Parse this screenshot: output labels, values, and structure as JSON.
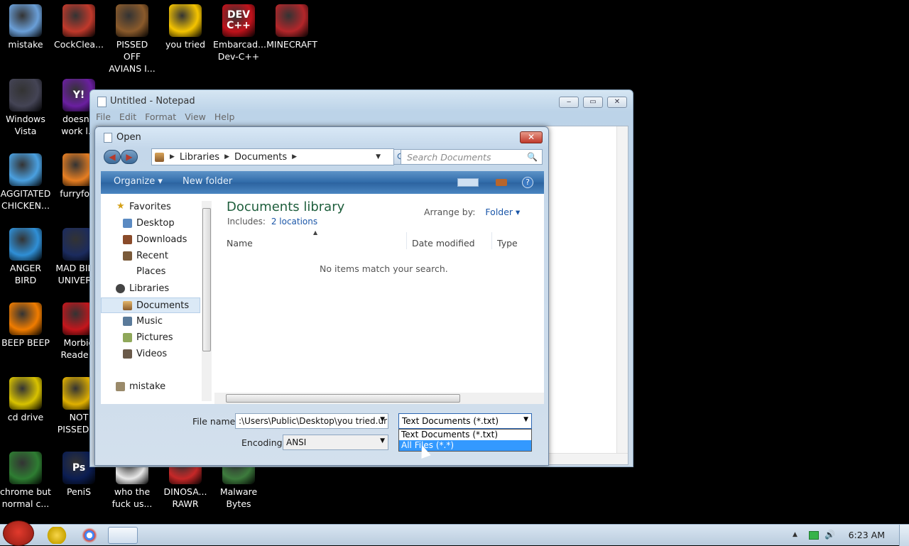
{
  "desktop_icons": [
    {
      "label": "mistake",
      "icon": "computer-icon",
      "color": "#6a9fd8"
    },
    {
      "label": "CockClea...",
      "icon": "ccleaner-icon",
      "color": "#c0392b"
    },
    {
      "label": "PISSED OFF\nAVIANS I...",
      "icon": "angry-birds-seasons-icon",
      "color": "#8a5a2b"
    },
    {
      "label": "you tried",
      "icon": "star-icon",
      "color": "#f5c400"
    },
    {
      "label": "Embarcad...\nDev-C++",
      "icon": "devcpp-icon",
      "color": "#c0121b",
      "glyph": "DEV\nC++"
    },
    {
      "label": "MINECRAFT",
      "icon": "minecraft-icon",
      "color": "#b3262a"
    },
    {
      "label": "Windows\nVista",
      "icon": "recycle-bin-icon",
      "color": "#445"
    },
    {
      "label": "doesn't\nwork l...",
      "icon": "yahoo-icon",
      "color": "#6a1fa0",
      "glyph": "Y!"
    },
    {
      "label": "AGGITATED\nCHICKEN...",
      "icon": "angry-birds-icon",
      "color": "#4aa0e0"
    },
    {
      "label": "furryfo...",
      "icon": "firefox-icon",
      "color": "#e67e22"
    },
    {
      "label": "ANGER\nBIRD",
      "icon": "angry-birds-icon",
      "color": "#2f8fd6"
    },
    {
      "label": "MAD BIR...\nUNIVER...",
      "icon": "angry-birds-space-icon",
      "color": "#1b2b5e"
    },
    {
      "label": "BEEP BEEP",
      "icon": "vlc-icon",
      "color": "#f07c00"
    },
    {
      "label": "Morbid\nReade...",
      "icon": "adobe-reader-icon",
      "color": "#c4161c"
    },
    {
      "label": "cd drive",
      "icon": "cd-drive-icon",
      "color": "#d8c200"
    },
    {
      "label": "NOT\nPISSED ...",
      "icon": "bad-piggies-icon",
      "color": "#e0b000"
    },
    {
      "label": "chrome but\nnormal c...",
      "icon": "chrome-icon",
      "color": "#2e7d32"
    },
    {
      "label": "PeniS",
      "icon": "photoshop-icon",
      "color": "#0b1d52",
      "glyph": "Ps"
    },
    {
      "label": "who the\nfuck us...",
      "icon": "bolt-icon",
      "color": "#e8e8e8"
    },
    {
      "label": "DINOSA...\nRAWR",
      "icon": "angry-birds-icon",
      "color": "#c62828"
    },
    {
      "label": "Malware\nBytes",
      "icon": "shield-check-icon",
      "color": "#3d7b3d"
    }
  ],
  "notepad": {
    "title": "Untitled - Notepad",
    "menu": [
      "File",
      "Edit",
      "Format",
      "View",
      "Help"
    ],
    "minimize_glyph": "‒",
    "maximize_glyph": "▭",
    "close_glyph": "✕"
  },
  "dialog": {
    "title": "Open",
    "close_glyph": "✕",
    "back_glyph": "◀",
    "forward_glyph": "▶",
    "breadcrumb": [
      "Libraries",
      "Documents"
    ],
    "search_placeholder": "Search Documents",
    "search_icon": "🔍",
    "refresh_glyph": "⟳",
    "toolbar": {
      "organize": "Organize ▾",
      "new_folder": "New folder",
      "help": "?"
    },
    "nav": {
      "favorites": "Favorites",
      "desktop": "Desktop",
      "downloads": "Downloads",
      "recent": "Recent Places",
      "libraries": "Libraries",
      "documents": "Documents",
      "music": "Music",
      "pictures": "Pictures",
      "videos": "Videos",
      "mistake": "mistake"
    },
    "library_title": "Documents library",
    "includes_label": "Includes:",
    "includes_link": "2 locations",
    "arrange_label": "Arrange by:",
    "arrange_value": "Folder ▾",
    "columns": [
      "Name",
      "Date modified",
      "Type"
    ],
    "empty_message": "No items match your search.",
    "file_name_label": "File name:",
    "file_name_value": ":\\Users\\Public\\Desktop\\you tried.url",
    "encoding_label": "Encoding:",
    "encoding_value": "ANSI",
    "file_type_value": "Text Documents (*.txt)",
    "file_type_options": [
      "Text Documents (*.txt)",
      "All Files  (*.*)"
    ],
    "highlighted_option": "All Files  (*.*)"
  },
  "taskbar": {
    "clock": "6:23 AM",
    "tray_arrow": "▲",
    "volume_icon": "🔊"
  }
}
